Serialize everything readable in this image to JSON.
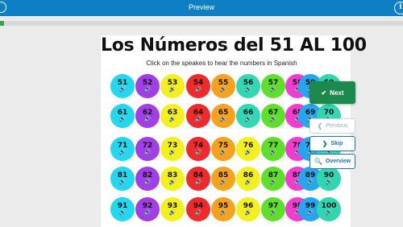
{
  "topbar": {
    "title": "Preview",
    "info_icon": "i"
  },
  "progress": {
    "fraction": 0.01
  },
  "slide": {
    "title": "Los Números del 51 AL 100",
    "subtitle": "Click on the speakes to hear the numbers in Spanish",
    "speaker_icon": "🔊",
    "rows": [
      [
        {
          "n": "51",
          "c": "#22d8f0"
        },
        {
          "n": "52",
          "c": "#a23ee6"
        },
        {
          "n": "53",
          "c": "#f4f01e"
        },
        {
          "n": "54",
          "c": "#f02a2a"
        },
        {
          "n": "55",
          "c": "#f7a21d"
        },
        {
          "n": "56",
          "c": "#2fd9b4"
        },
        {
          "n": "57",
          "c": "#5ee02a"
        },
        {
          "n": "58",
          "c": "#f53ad0"
        },
        {
          "n": "59",
          "c": "#27a6f0"
        },
        {
          "n": "60",
          "c": "#2fd6b0"
        }
      ],
      [
        {
          "n": "61",
          "c": "#22d8f0"
        },
        {
          "n": "62",
          "c": "#a23ee6"
        },
        {
          "n": "63",
          "c": "#f4f01e"
        },
        {
          "n": "64",
          "c": "#f02a2a"
        },
        {
          "n": "65",
          "c": "#f7a21d"
        },
        {
          "n": "66",
          "c": "#2fd9b4"
        },
        {
          "n": "67",
          "c": "#5ee02a"
        },
        {
          "n": "68",
          "c": "#f53ad0"
        },
        {
          "n": "69",
          "c": "#27a6f0"
        },
        {
          "n": "70",
          "c": "#2fd6b0"
        }
      ],
      [
        {
          "n": "71",
          "c": "#22d8f0"
        },
        {
          "n": "72",
          "c": "#a23ee6"
        },
        {
          "n": "73",
          "c": "#f4f01e"
        },
        {
          "n": "74",
          "c": "#f02a2a"
        },
        {
          "n": "75",
          "c": "#f7a21d"
        },
        {
          "n": "76",
          "c": "#f4f01e"
        },
        {
          "n": "77",
          "c": "#5ee02a"
        },
        {
          "n": "78",
          "c": "#f53ad0"
        },
        {
          "n": "79",
          "c": "#27a6f0"
        },
        {
          "n": "80",
          "c": "#2fd6b0"
        }
      ],
      [
        {
          "n": "81",
          "c": "#22d8f0"
        },
        {
          "n": "82",
          "c": "#a23ee6"
        },
        {
          "n": "83",
          "c": "#f4f01e"
        },
        {
          "n": "84",
          "c": "#f02a2a"
        },
        {
          "n": "85",
          "c": "#f7a21d"
        },
        {
          "n": "86",
          "c": "#f4f01e"
        },
        {
          "n": "87",
          "c": "#5ee02a"
        },
        {
          "n": "88",
          "c": "#f53ad0"
        },
        {
          "n": "89",
          "c": "#27a6f0"
        },
        {
          "n": "90",
          "c": "#2fd6b0"
        }
      ],
      [
        {
          "n": "91",
          "c": "#22d8f0"
        },
        {
          "n": "92",
          "c": "#a23ee6"
        },
        {
          "n": "93",
          "c": "#f4f01e"
        },
        {
          "n": "94",
          "c": "#f02a2a"
        },
        {
          "n": "95",
          "c": "#f7a21d"
        },
        {
          "n": "96",
          "c": "#f4f01e"
        },
        {
          "n": "97",
          "c": "#5ee02a"
        },
        {
          "n": "98",
          "c": "#f53ad0"
        },
        {
          "n": "99",
          "c": "#27a6f0"
        },
        {
          "n": "100",
          "c": "#2fd6b0"
        }
      ]
    ]
  },
  "nav": {
    "next_label": "Next",
    "previous_label": "Previous",
    "skip_label": "Skip",
    "overview_label": "Overview",
    "next_icon": "✔",
    "previous_icon": "❮",
    "skip_icon": "❯",
    "overview_icon": "🔍"
  }
}
